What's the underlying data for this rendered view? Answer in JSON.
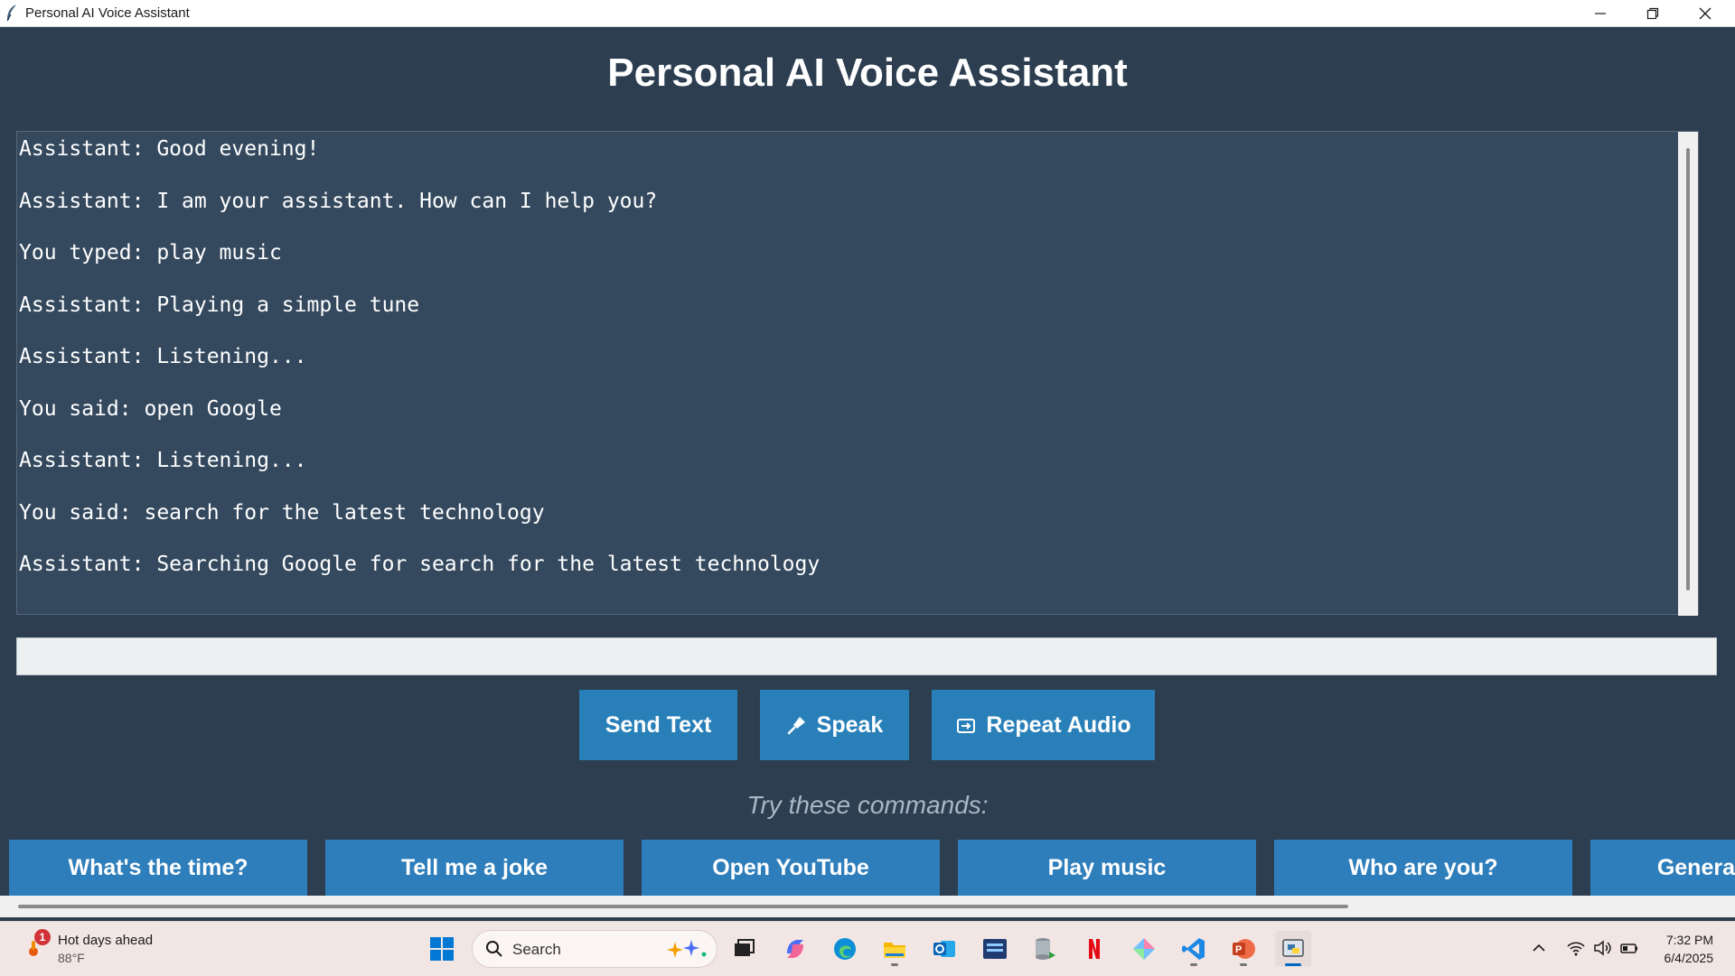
{
  "window": {
    "title": "Personal AI Voice Assistant"
  },
  "app": {
    "heading": "Personal AI Voice Assistant",
    "chat_lines": [
      "Assistant: Good evening!",
      "Assistant: I am your assistant. How can I help you?",
      "You typed: play music",
      "Assistant: Playing a simple tune",
      "Assistant: Listening...",
      "You said: open Google",
      "Assistant: Listening...",
      "You said: search for the latest technology",
      "Assistant: Searching Google for search for the latest technology"
    ],
    "input": {
      "value": "",
      "placeholder": ""
    },
    "buttons": {
      "send": "Send Text",
      "speak": "Speak",
      "repeat": "Repeat Audio"
    },
    "try_label": "Try these commands:",
    "commands": [
      "What's the time?",
      "Tell me a joke",
      "Open YouTube",
      "Play music",
      "Who are you?",
      "Genera"
    ],
    "colors": {
      "background": "#2c3e50",
      "chat_background": "#34495e",
      "button": "#2980b9"
    }
  },
  "taskbar": {
    "weather": {
      "badge": "1",
      "headline": "Hot days ahead",
      "temp": "88°F"
    },
    "search_label": "Search",
    "pinned_icons": [
      "task-view-icon",
      "copilot-icon",
      "edge-icon",
      "file-explorer-icon",
      "outlook-icon",
      "prime-video-icon",
      "database-app-icon",
      "netflix-icon",
      "gemini-app-icon",
      "vscode-icon",
      "powerpoint-icon",
      "python-app-icon"
    ],
    "clock": {
      "time": "7:32 PM",
      "date": "6/4/2025"
    }
  }
}
